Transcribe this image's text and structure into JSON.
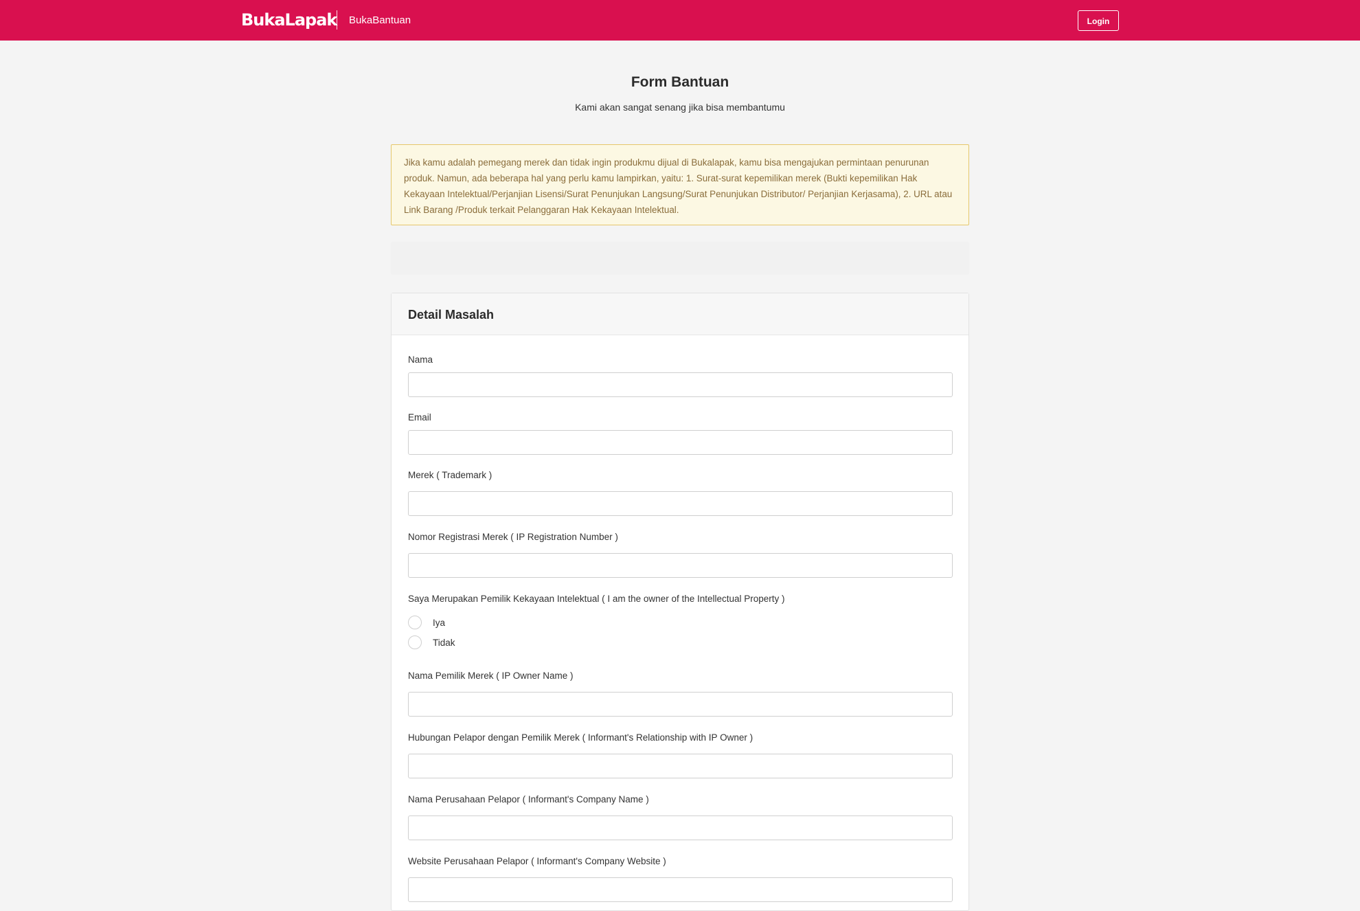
{
  "header": {
    "logo_text": "BukaLapak",
    "subbrand": "BukaBantuan",
    "login_label": "Login"
  },
  "page": {
    "title": "Form Bantuan",
    "subtitle": "Kami akan sangat senang jika bisa membantumu"
  },
  "notice": {
    "text": "Jika kamu adalah pemegang merek dan tidak ingin produkmu dijual di Bukalapak, kamu bisa mengajukan permintaan penurunan produk. Namun, ada beberapa hal yang perlu kamu lampirkan, yaitu: 1. Surat-surat kepemilikan merek (Bukti kepemilikan Hak Kekayaan Intelektual/Perjanjian Lisensi/Surat Penunjukan Langsung/Surat Penunjukan Distributor/ Perjanjian Kerjasama), 2. URL atau Link Barang /Produk terkait Pelanggaran Hak Kekayaan Intelektual."
  },
  "form": {
    "title": "Detail Masalah",
    "fields": {
      "nama": {
        "label": "Nama",
        "value": ""
      },
      "email": {
        "label": "Email",
        "value": ""
      },
      "merek": {
        "label": "Merek ( Trademark )",
        "value": ""
      },
      "nomor_registrasi": {
        "label": "Nomor Registrasi Merek ( IP Registration Number )",
        "value": ""
      },
      "pemilik": {
        "label": "Saya Merupakan Pemilik Kekayaan Intelektual ( I am the owner of the Intellectual Property )",
        "options": [
          "Iya",
          "Tidak"
        ],
        "selected": ""
      },
      "nama_pemilik": {
        "label": "Nama Pemilik Merek ( IP Owner Name )",
        "value": ""
      },
      "hubungan": {
        "label": "Hubungan Pelapor dengan Pemilik Merek ( Informant's Relationship with IP Owner )",
        "value": ""
      },
      "nama_perusahaan": {
        "label": "Nama Perusahaan Pelapor ( Informant's Company Name )",
        "value": ""
      },
      "website": {
        "label": "Website Perusahaan Pelapor ( Informant's Company Website )",
        "value": ""
      }
    }
  }
}
